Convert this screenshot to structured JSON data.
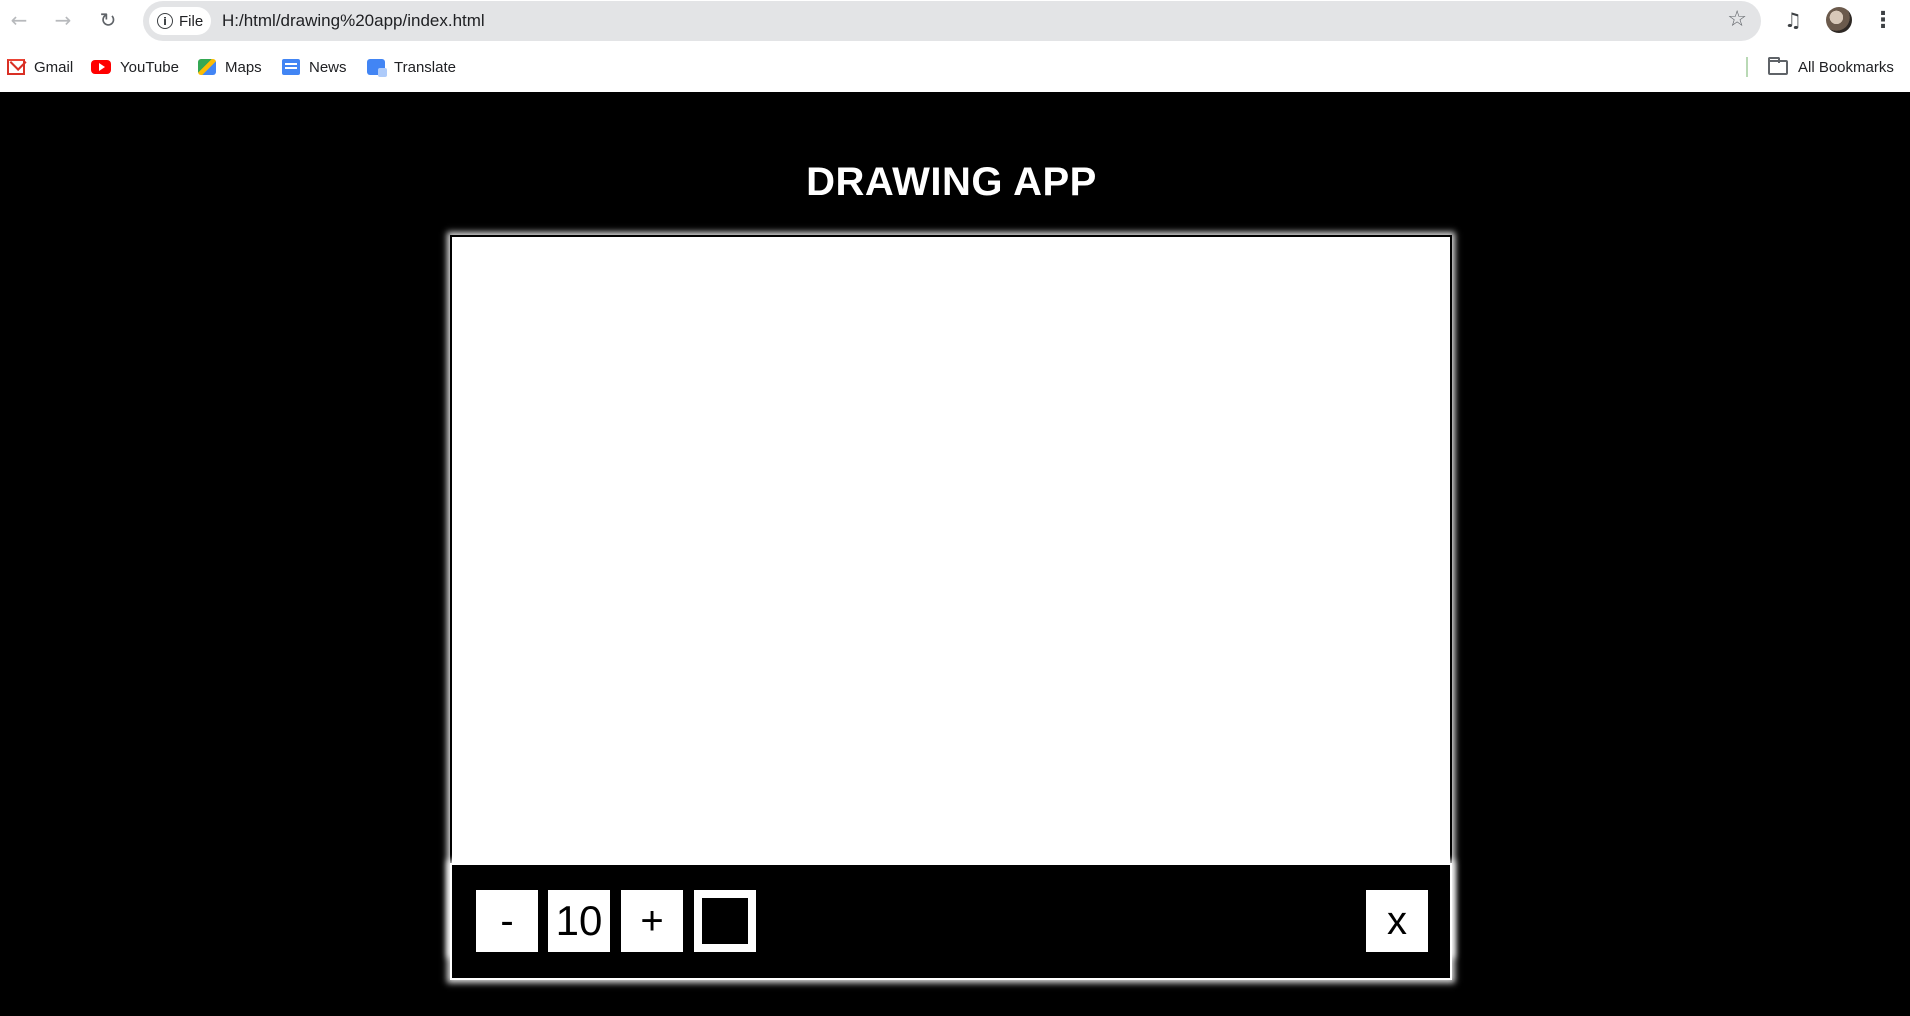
{
  "browser": {
    "file_label": "File",
    "url": "H:/html/drawing%20app/index.html",
    "bookmarks": [
      {
        "label": "Gmail",
        "icon": "gmail-icon"
      },
      {
        "label": "YouTube",
        "icon": "youtube-icon"
      },
      {
        "label": "Maps",
        "icon": "maps-icon"
      },
      {
        "label": "News",
        "icon": "news-icon"
      },
      {
        "label": "Translate",
        "icon": "translate-icon"
      }
    ],
    "all_bookmarks_label": "All Bookmarks",
    "icons": {
      "back": "←",
      "forward": "→",
      "reload": "↻",
      "star": "☆",
      "menu": "⋮",
      "media": "♫"
    }
  },
  "app": {
    "title": "DRAWING APP",
    "toolbox": {
      "decrease_label": "-",
      "size_value": "10",
      "increase_label": "+",
      "current_color": "#000000",
      "clear_label": "x"
    }
  }
}
